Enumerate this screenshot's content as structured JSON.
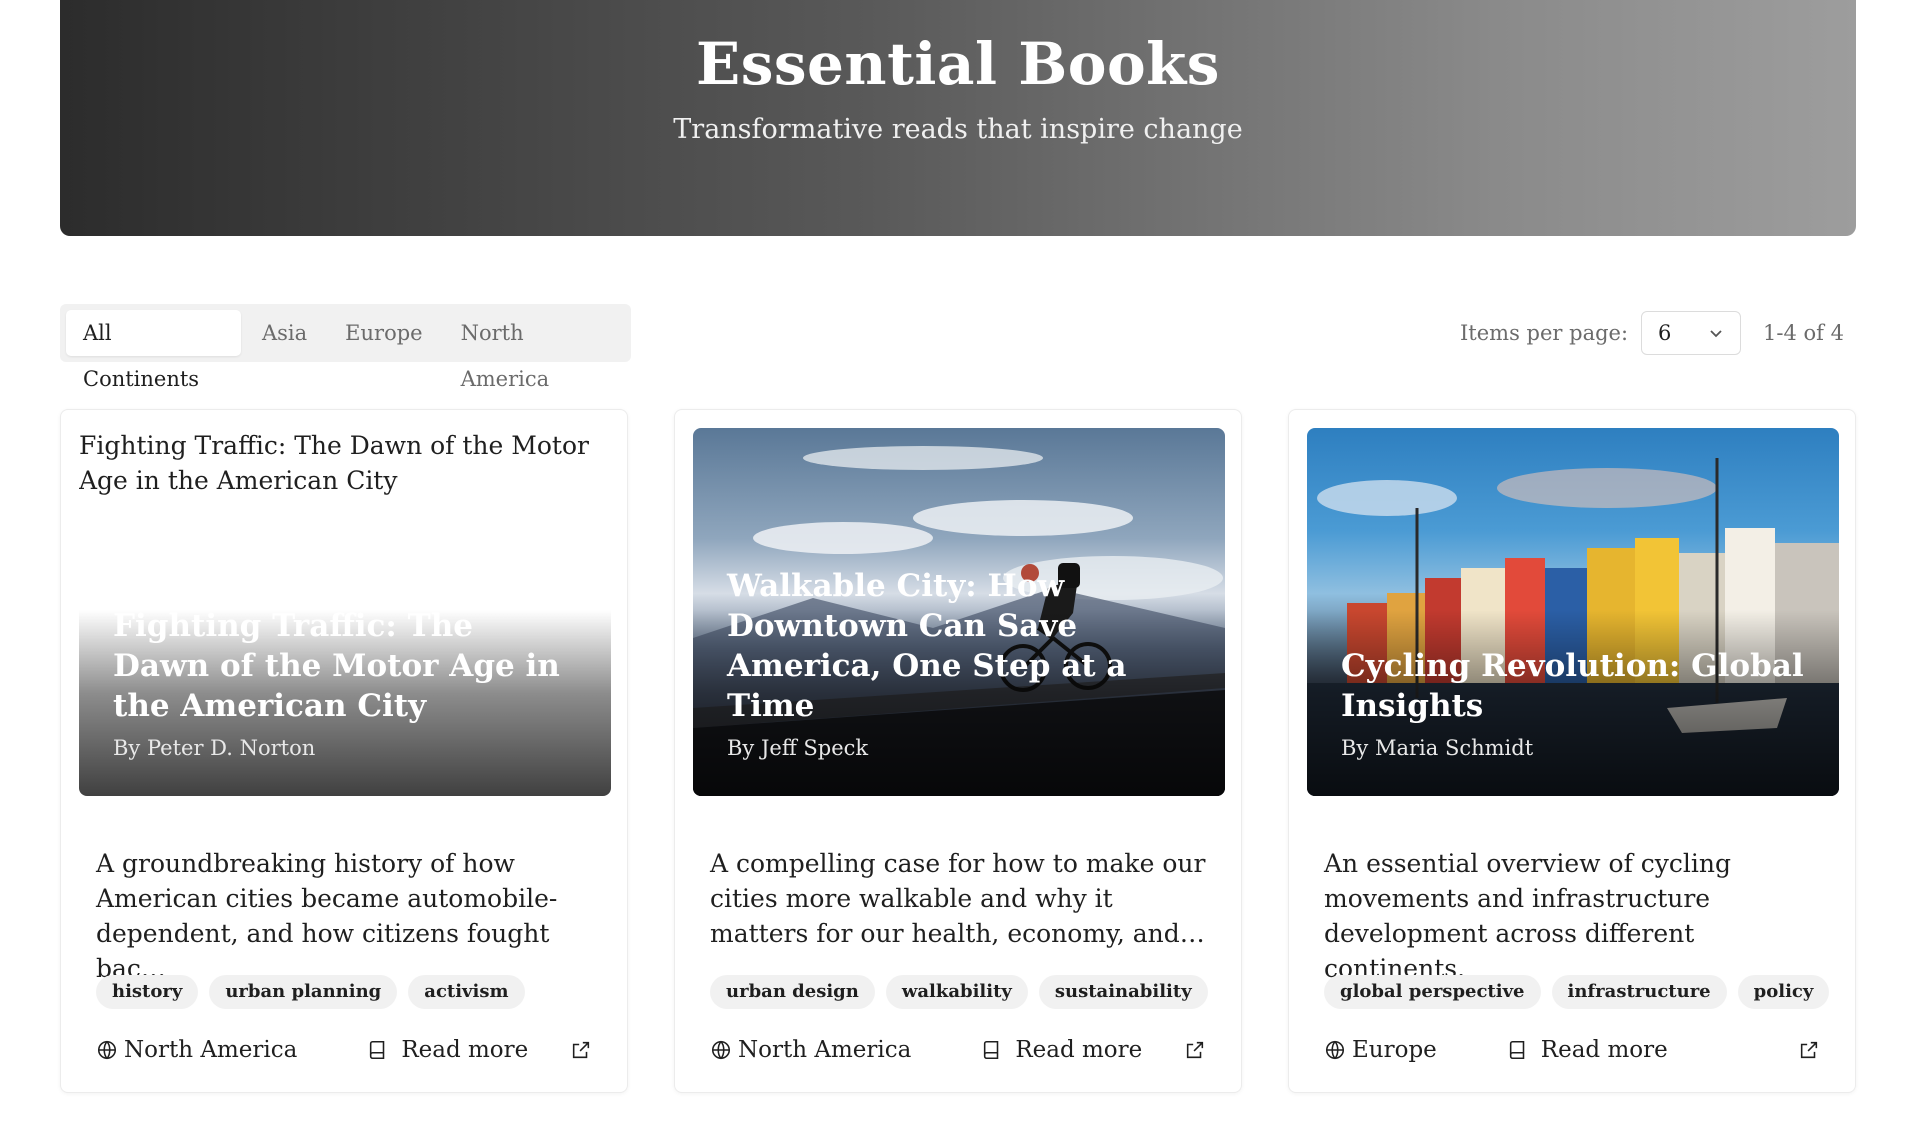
{
  "header": {
    "title": "Essential Books",
    "subtitle": "Transformative reads that inspire change"
  },
  "filters": {
    "tabs": [
      {
        "label": "All Continents",
        "active": true
      },
      {
        "label": "Asia",
        "active": false
      },
      {
        "label": "Europe",
        "active": false
      },
      {
        "label": "North America",
        "active": false
      }
    ]
  },
  "pagination": {
    "label": "Items per page:",
    "per_page": "6",
    "range": "1-4 of 4"
  },
  "books": [
    {
      "image_alt": "Fighting Traffic: The Dawn of the Motor Age in the American City",
      "title": "Fighting Traffic: The Dawn of the Motor Age in the American City",
      "author": "By Peter D. Norton",
      "description": "A groundbreaking history of how American cities became automobile-dependent, and how citizens fought bac…",
      "tags": [
        "history",
        "urban planning",
        "activism"
      ],
      "region": "North America",
      "read_more": "Read more"
    },
    {
      "title": "Walkable City: How Downtown Can Save America, One Step at a Time",
      "author": "By Jeff Speck",
      "description": "A compelling case for how to make our cities more walkable and why it matters for our health, economy, and…",
      "tags": [
        "urban design",
        "walkability",
        "sustainability"
      ],
      "region": "North America",
      "read_more": "Read more"
    },
    {
      "title": "Cycling Revolution: Global Insights",
      "author": "By Maria Schmidt",
      "description": "An essential overview of cycling movements and infrastructure development across different continents.",
      "tags": [
        "global perspective",
        "infrastructure",
        "policy"
      ],
      "region": "Europe",
      "read_more": "Read more"
    }
  ],
  "icons": {
    "region": "globe-icon",
    "read_more": "book-icon",
    "external": "external-link-icon",
    "select": "chevron-down-icon"
  }
}
